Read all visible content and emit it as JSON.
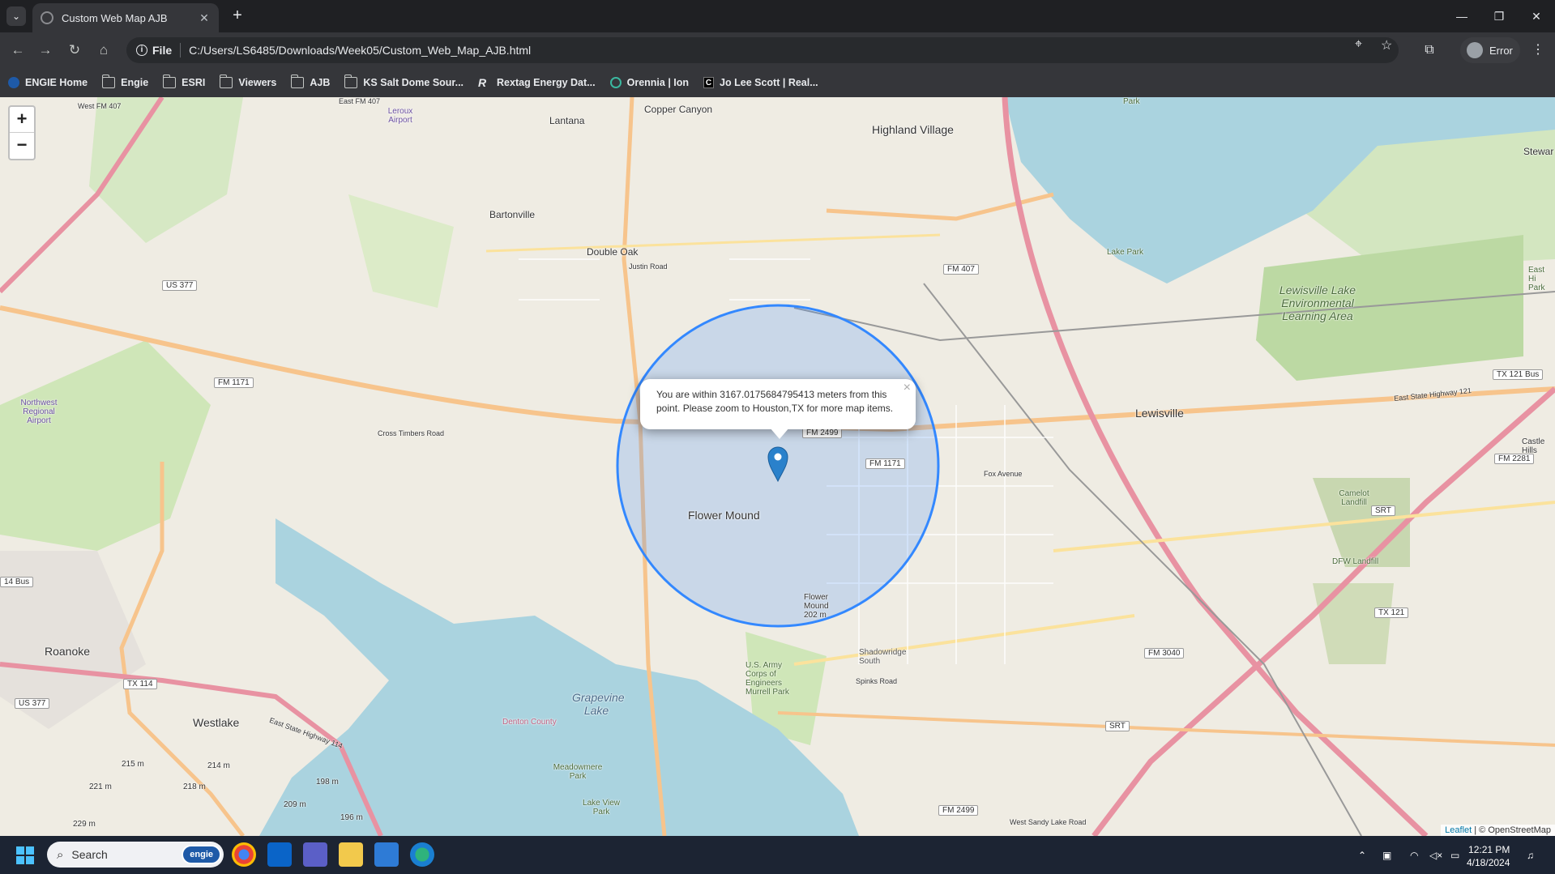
{
  "browser": {
    "tab_title": "Custom Web Map AJB",
    "address": "C:/Users/LS6485/Downloads/Week05/Custom_Web_Map_AJB.html",
    "address_scheme_label": "File",
    "profile_label": "Error"
  },
  "bookmarks": [
    {
      "label": "ENGIE Home",
      "icon": "engie-icon"
    },
    {
      "label": "Engie",
      "icon": "folder-icon"
    },
    {
      "label": "ESRI",
      "icon": "folder-icon"
    },
    {
      "label": "Viewers",
      "icon": "folder-icon"
    },
    {
      "label": "AJB",
      "icon": "folder-icon"
    },
    {
      "label": "KS Salt Dome Sour...",
      "icon": "folder-icon"
    },
    {
      "label": "Rextag Energy Dat...",
      "icon": "rextag-icon"
    },
    {
      "label": "Orennia | Ion",
      "icon": "orennia-icon"
    },
    {
      "label": "Jo Lee Scott | Real...",
      "icon": "jls-icon"
    }
  ],
  "map": {
    "zoom_in_label": "+",
    "zoom_out_label": "−",
    "popup_text": "You are within 3167.0175684795413 meters from this point. Please zoom to Houston,TX for more map items.",
    "popup_close": "×",
    "radius_m": 3167.0175684795413,
    "circle_color": "#3388ff",
    "marker_color": "#2a81cb",
    "attribution_leaflet": "Leaflet",
    "attribution_rest": " | © OpenStreetMap",
    "places": {
      "lantana": "Lantana",
      "copper_canyon": "Copper Canyon",
      "highland_village": "Highland Village",
      "bartonville": "Bartonville",
      "double_oak": "Double Oak",
      "flower_mound": "Flower Mound",
      "lewisville": "Lewisville",
      "roanoke": "Roanoke",
      "westlake": "Westlake",
      "grapevine_lake": "Grapevine Lake",
      "lewisville_lake_env": "Lewisville Lake Environmental Learning Area",
      "northwest_regional_airport": "Northwest Regional Airport",
      "leroux_airport": "Leroux Airport",
      "stewart": "Stewar",
      "denton_county": "Denton County",
      "army_corps": "U.S. Army Corps of Engineers Murrell Park",
      "shadowridge": "Shadowridge South",
      "camelot_landfill": "Camelot Landfill",
      "dfw_landfill": "DFW Landfill",
      "meadowmere": "Meadowmere Park",
      "lake_view_park": "Lake View Park",
      "fox_avenue": "Fox Avenue",
      "cross_timbers_road": "Cross Timbers Road",
      "spinks_road": "Spinks Road",
      "justin_road": "Justin Road",
      "east_fm_407": "East FM 407",
      "west_fm_407": "West FM 407",
      "state_hwy_114": "East State Highway 114",
      "state_hwy_121": "East State Highway 121",
      "west_sandy_lake": "West Sandy Lake Road",
      "flower_mound_elev": "Flower Mound 202 m",
      "lake_park": "Lake Park",
      "park": "Park",
      "east_hill_park": "East Hi Park",
      "castle_hills": "Castle Hills",
      "elev_215": "215 m",
      "elev_214": "214 m",
      "elev_221": "221 m",
      "elev_218": "218 m",
      "elev_198": "198 m",
      "elev_209": "209 m",
      "elev_196": "196 m",
      "elev_229": "229 m"
    },
    "shields": {
      "fm407": "FM 407",
      "fm1171_w": "FM 1171",
      "fm1171_e": "FM 1171",
      "us377": "US 377",
      "us377_s": "US 377",
      "tx114": "TX 114",
      "tx121": "TX 121",
      "tx121bus": "TX 121 Bus",
      "fm2281": "FM 2281",
      "fm3040": "FM 3040",
      "fm2499": "FM 2499",
      "srt": "SRT",
      "srt2": "SRT",
      "bus14": "14 Bus",
      "fm2499_n": "FM 2499"
    }
  },
  "taskbar": {
    "search_placeholder": "Search",
    "search_badge": "engie",
    "time": "12:21 PM",
    "date": "4/18/2024"
  }
}
